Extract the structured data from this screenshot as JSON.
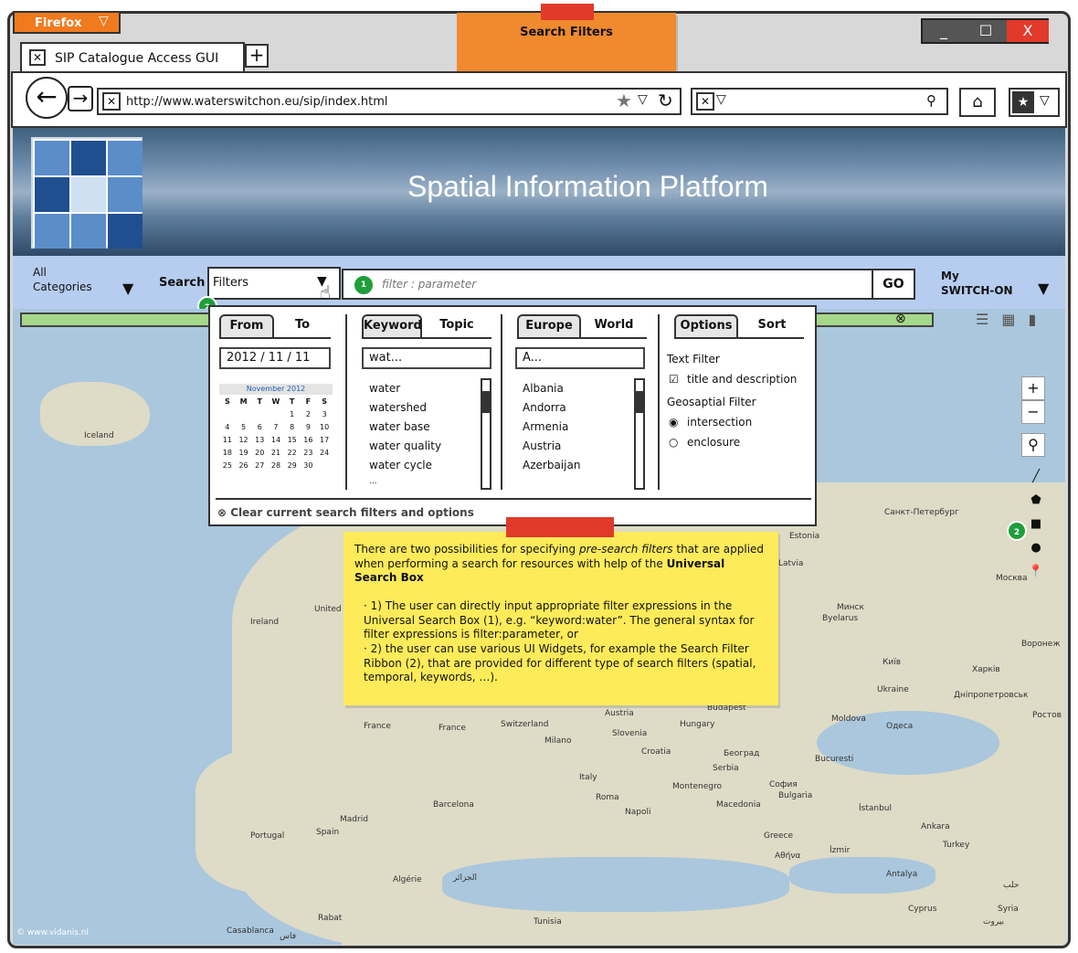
{
  "browser": {
    "menu_label": "Firefox",
    "tab_title": "SIP Catalogue Access GUI",
    "new_tab": "+",
    "url": "http://www.waterswitchon.eu/sip/index.html",
    "window_buttons": [
      "_",
      "☐",
      "X"
    ]
  },
  "sticky_title": "Search Filters",
  "header": {
    "title": "Spatial Information Platform"
  },
  "filterbar": {
    "categories": "All Categories",
    "search_label": "Search",
    "filters_dropdown": "Filters",
    "search_placeholder": "filter : parameter",
    "go": "GO",
    "my_label": "My",
    "my_switchon": "SWITCH-ON",
    "badge1": "1",
    "badge2": "2"
  },
  "popup": {
    "date_tabs": [
      "From",
      "To"
    ],
    "date_value": "2012 / 11 / 11",
    "calendar": {
      "month": "November 2012",
      "weekdays": [
        "S",
        "M",
        "T",
        "W",
        "T",
        "F",
        "S"
      ],
      "rows": [
        [
          "",
          "",
          "",
          "",
          "1",
          "2",
          "3"
        ],
        [
          "4",
          "5",
          "6",
          "7",
          "8",
          "9",
          "10"
        ],
        [
          "11",
          "12",
          "13",
          "14",
          "15",
          "16",
          "17"
        ],
        [
          "18",
          "19",
          "20",
          "21",
          "22",
          "23",
          "24"
        ],
        [
          "25",
          "26",
          "27",
          "28",
          "29",
          "30",
          ""
        ]
      ]
    },
    "keyword_tabs": [
      "Keyword",
      "Topic"
    ],
    "keyword_input": "wat...",
    "keywords": [
      "water",
      "watershed",
      "water base",
      "water quality",
      "water cycle",
      "..."
    ],
    "region_tabs": [
      "Europe",
      "World"
    ],
    "region_input": "A...",
    "regions": [
      "Albania",
      "Andorra",
      "Armenia",
      "Austria",
      "Azerbaijan"
    ],
    "option_tabs": [
      "Options",
      "Sort"
    ],
    "text_filter_label": "Text Filter",
    "text_filter_option": "title and description",
    "geo_filter_label": "Geosaptial Filter",
    "geo_options": [
      "intersection",
      "enclosure"
    ],
    "clear_label": "Clear current search filters and options"
  },
  "map": {
    "labels": [
      "Iceland",
      "Ireland",
      "United",
      "Estonia",
      "Latvia",
      "Санкт-Петербург",
      "Москва",
      "Минск",
      "Byelarus",
      "Воронеж",
      "Київ",
      "Харків",
      "Ukraine",
      "Днiпропетровськ",
      "Ростов",
      "Moldova",
      "Одеса",
      "Budapest",
      "Austria",
      "Hungary",
      "France",
      "France",
      "Switzerland",
      "Milano",
      "Slovenia",
      "Croatia",
      "Београд",
      "Bucuresti",
      "Serbia",
      "Italy",
      "Roma",
      "Montenegro",
      "София",
      "Bulgaria",
      "Napoli",
      "Macedonia",
      "Barcelona",
      "Portugal",
      "Spain",
      "Madrid",
      "İstanbul",
      "Ankara",
      "Turkey",
      "Greece",
      "Αθήνα",
      "İzmir",
      "Antalya",
      "Algérie",
      "الجزائر",
      "Tunisia",
      "Rabat",
      "Casablanca",
      "فاس",
      "Cyprus",
      "Syria",
      "حلب",
      "بيروت",
      "© www.vidanis.nl"
    ],
    "zoom_in": "+",
    "zoom_out": "−"
  },
  "yellow_note": {
    "intro_1": "There are two possibilities for specifying ",
    "intro_em": "pre-search filters",
    "intro_2": " that are applied when performing a search for resources with help of the ",
    "intro_b": "Universal Search Box",
    "item1": "1) The user can directly input appropriate filter expressions in the Universal Search Box (1), e.g. “keyword:water”. The general syntax for filter expressions is filter:parameter, or",
    "item2": "2) the user can use  various UI Widgets, for example the Search Filter Ribbon (2), that are provided for different type of search filters (spatial, temporal, keywords, …)."
  }
}
